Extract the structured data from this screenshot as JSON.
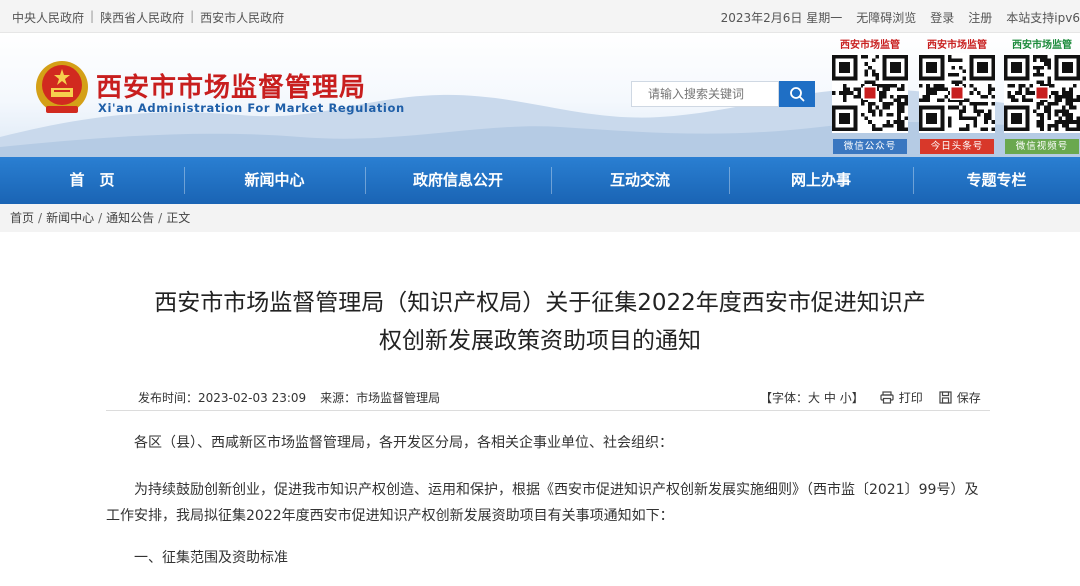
{
  "topbar": {
    "links": [
      "中央人民政府",
      "陕西省人民政府",
      "西安市人民政府"
    ],
    "date": "2023年2月6日 星期一",
    "accessibility": "无障碍浏览",
    "login": "登录",
    "register": "注册",
    "ipv6": "本站支持ipv6"
  },
  "header": {
    "title": "西安市市场监督管理局",
    "subtitle": "Xi'an Administration For Market Regulation",
    "search_placeholder": "请输入搜索关键词",
    "qr": [
      {
        "title": "西安市场监管",
        "caption": "微信公众号"
      },
      {
        "title": "西安市场监管",
        "caption": "今日头条号"
      },
      {
        "title": "西安市场监管",
        "caption": "微信视频号"
      }
    ]
  },
  "nav": [
    "首　页",
    "新闻中心",
    "政府信息公开",
    "互动交流",
    "网上办事",
    "专题专栏"
  ],
  "breadcrumb": [
    "首页",
    "新闻中心",
    "通知公告",
    "正文"
  ],
  "article": {
    "title_line1": "西安市市场监督管理局（知识产权局）关于征集2022年度西安市促进知识产",
    "title_line2": "权创新发展政策资助项目的通知",
    "publish_label": "发布时间：",
    "publish_time": "2023-02-03 23:09",
    "source_label": "来源：",
    "source": "市场监督管理局",
    "font_label": "【字体：",
    "font_large": "大",
    "font_medium": "中",
    "font_small": "小",
    "font_end": "】",
    "print": "打印",
    "save": "保存",
    "para1": "各区（县）、西咸新区市场监督管理局，各开发区分局，各相关企事业单位、社会组织：",
    "para2": "为持续鼓励创新创业，促进我市知识产权创造、运用和保护，根据《西安市促进知识产权创新发展实施细则》（西市监〔2021〕99号）及工作安排，我局拟征集2022年度西安市促进知识产权创新发展资助项目有关事项通知如下：",
    "para3": "一、征集范围及资助标准"
  },
  "colors": {
    "nav_blue": "#1a64b4",
    "title_red": "#c81e1e",
    "subtitle_blue": "#1f5fa8"
  }
}
